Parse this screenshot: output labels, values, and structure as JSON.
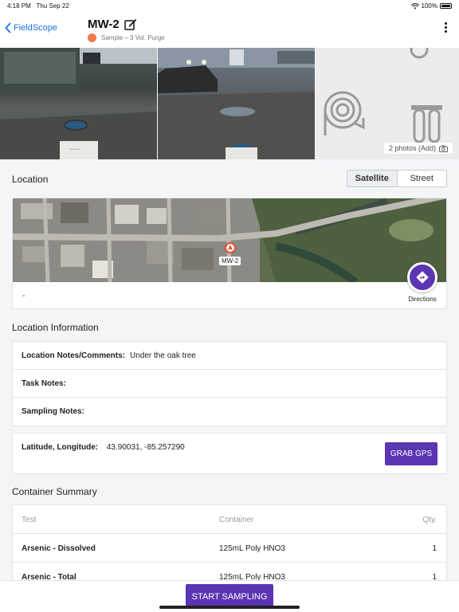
{
  "status_bar": {
    "time": "4:18 PM",
    "date": "Thu Sep 22",
    "battery": "100%"
  },
  "nav": {
    "back_label": "FieldScope",
    "title": "MW-2",
    "subtitle": "Sample – 3 Vol. Purge",
    "status_color": "#f47a4a",
    "icons": [
      "chevron-left-icon",
      "edit-icon",
      "more-vertical-icon"
    ]
  },
  "photos": {
    "count_label": "2 photos (Add)"
  },
  "location": {
    "title": "Location",
    "segments": [
      "Satellite",
      "Street"
    ],
    "selected_segment": "Satellite",
    "marker_label": "MW-2",
    "address": "-",
    "directions_label": "Directions"
  },
  "location_info": {
    "title": "Location Information",
    "rows": [
      {
        "label": "Location Notes/Comments:",
        "value": "Under the oak tree"
      },
      {
        "label": "Task Notes:",
        "value": ""
      },
      {
        "label": "Sampling Notes:",
        "value": ""
      }
    ],
    "latlng_label": "Latitude, Longitude:",
    "latlng_value": "43.90031, -85.257290",
    "grab_gps_label": "GRAB GPS"
  },
  "container_summary": {
    "title": "Container Summary",
    "headers": {
      "test": "Test",
      "container": "Container",
      "qty": "Qty."
    },
    "rows": [
      {
        "test": "Arsenic - Dissolved",
        "container": "125mL Poly HNO3",
        "qty": "1"
      },
      {
        "test": "Arsenic - Total",
        "container": "125mL Poly HNO3",
        "qty": "1"
      }
    ]
  },
  "footer": {
    "start_label": "START SAMPLING"
  },
  "colors": {
    "accent": "#5b35b3",
    "link": "#1a73e8"
  }
}
